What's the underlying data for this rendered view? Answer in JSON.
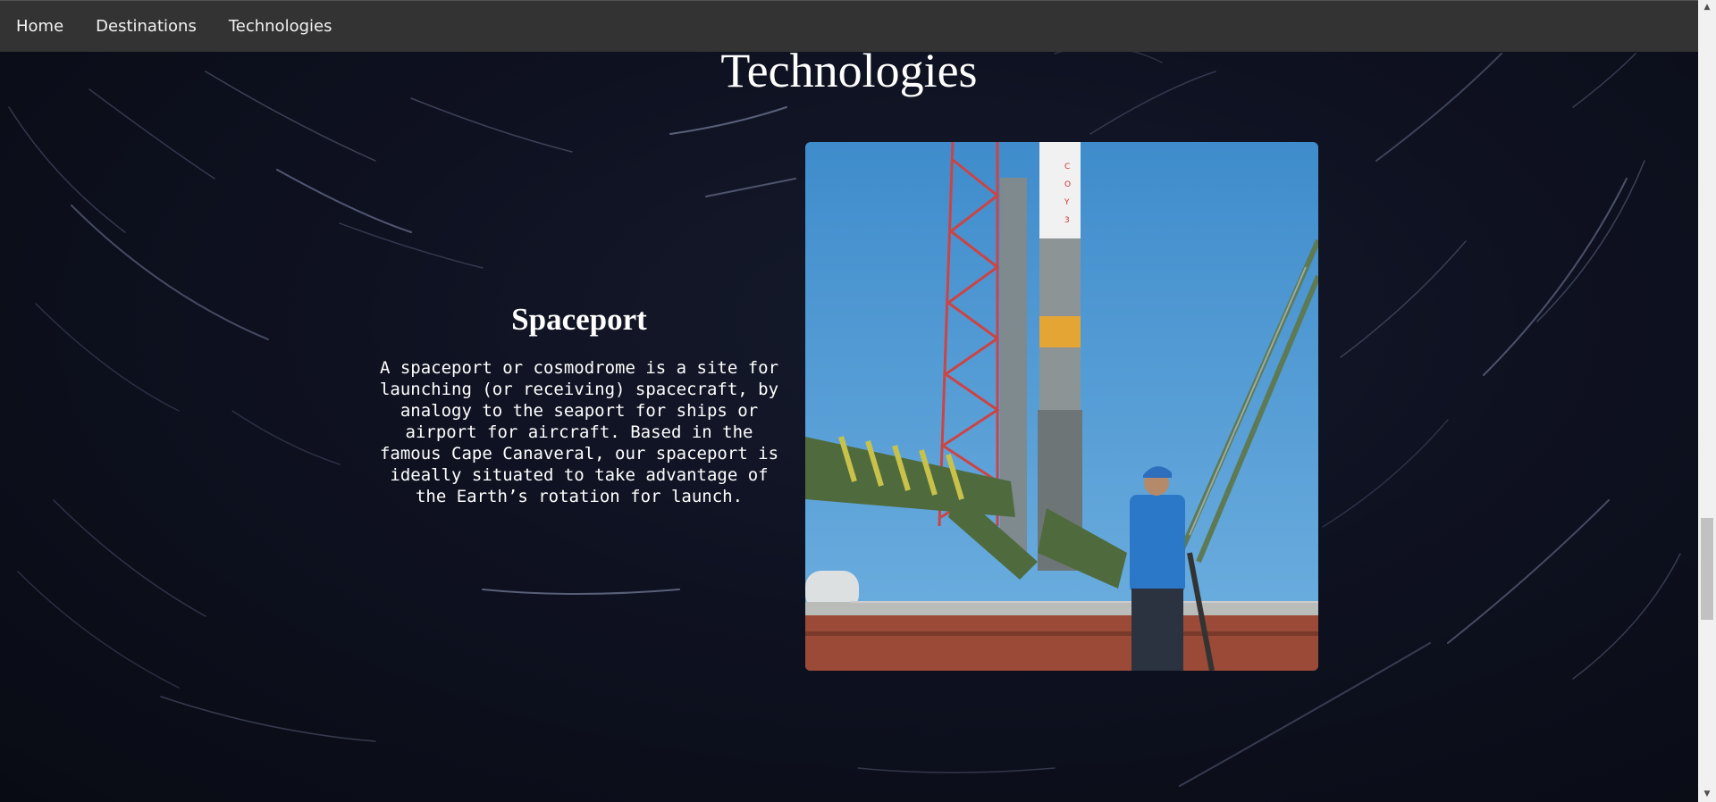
{
  "nav": {
    "items": [
      {
        "label": "Home"
      },
      {
        "label": "Destinations"
      },
      {
        "label": "Technologies"
      }
    ]
  },
  "page": {
    "title": "Technologies"
  },
  "technology": {
    "heading": "Spaceport",
    "description": "A spaceport or cosmodrome is a site for launching (or receiving) spacecraft, by analogy to the seaport for ships or airport for aircraft. Based in the famous Cape Canaveral, our spaceport is ideally situated to take advantage of the Earth’s rotation for launch.",
    "image_icon": "rocket-launchpad-photo"
  },
  "colors": {
    "navbar": "#333333",
    "background": "#0c0e17",
    "text": "#ffffff",
    "sky": "#4a97d2"
  }
}
